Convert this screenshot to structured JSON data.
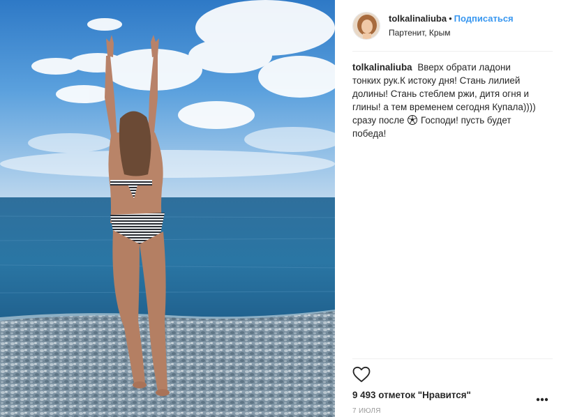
{
  "post": {
    "username": "tolkalinaliuba",
    "separator": "•",
    "follow_label": "Подписаться",
    "location": "Партенит, Крым",
    "caption_username": "tolkalinaliuba",
    "caption_part1": "Вверх обрати ладони тонких рук.К истоку дня! Стань лилией долины! Стань стеблем ржи, дитя огня и глины! а тем временем сегодня Купала)))) сразу после",
    "caption_part2": "Господи! пусть будет победа!",
    "likes": "9 493 отметок \"Нравится\"",
    "date": "7 июля"
  },
  "icons": {
    "like": "heart-outline-icon",
    "more": "more-options-icon",
    "soccer": "soccer-ball-emoji"
  },
  "colors": {
    "follow": "#3897f0",
    "text": "#262626",
    "muted": "#999999",
    "divider": "#efefef"
  }
}
